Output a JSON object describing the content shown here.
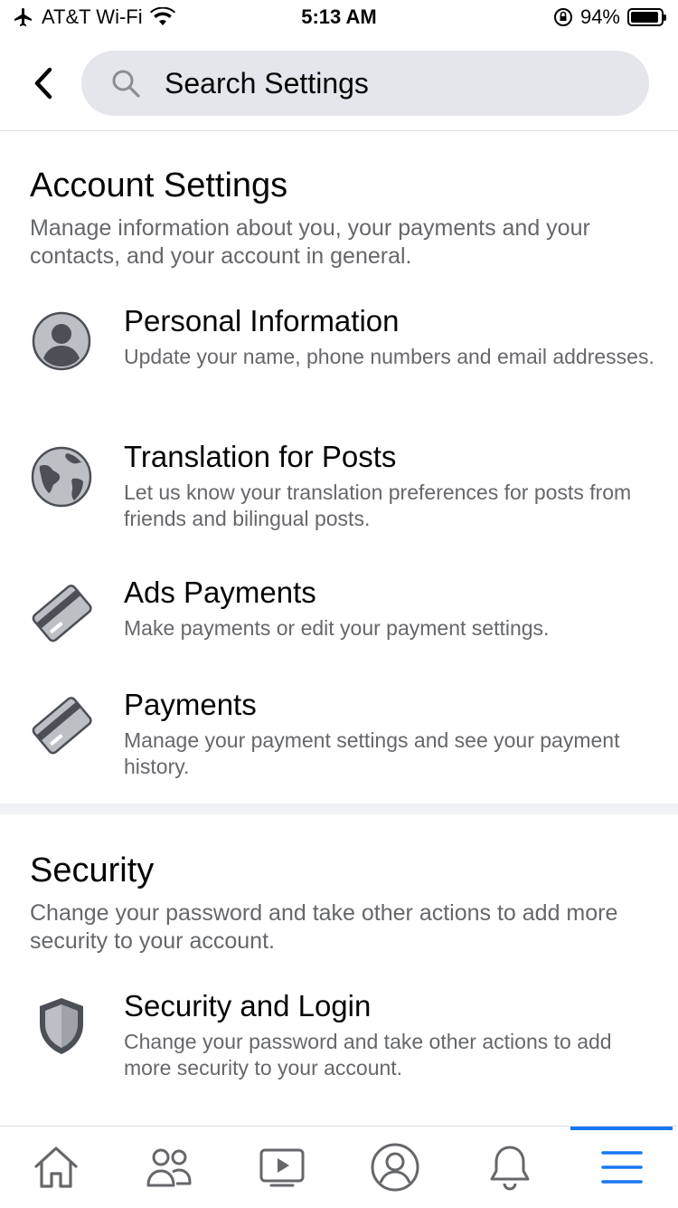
{
  "status_bar": {
    "carrier": "AT&T Wi-Fi",
    "time": "5:13 AM",
    "battery": "94%",
    "battery_level": 0.94,
    "icons": [
      "airplane-icon",
      "wifi-icon",
      "rotation-lock-icon",
      "battery-icon"
    ]
  },
  "header": {
    "back_icon": "chevron-left-icon",
    "search_placeholder": "Search Settings",
    "search_icon": "search-icon"
  },
  "sections": [
    {
      "title": "Account Settings",
      "description": "Manage information about you, your payments and your contacts, and your account in general.",
      "items": [
        {
          "title": "Personal Information",
          "description": "Update your name, phone numbers and email addresses.",
          "icon": "person-icon"
        },
        {
          "title": "Translation for Posts",
          "description": "Let us know your translation preferences for posts from friends and bilingual posts.",
          "icon": "globe-icon"
        },
        {
          "title": "Ads Payments",
          "description": "Make payments or edit your payment settings.",
          "icon": "credit-card-icon"
        },
        {
          "title": "Payments",
          "description": "Manage your payment settings and see your payment history.",
          "icon": "credit-card-icon"
        }
      ]
    },
    {
      "title": "Security",
      "description": "Change your password and take other actions to add more security to your account.",
      "items": [
        {
          "title": "Security and Login",
          "description": "Change your password and take other actions to add more security to your account.",
          "icon": "shield-icon"
        }
      ]
    }
  ],
  "tab_bar": {
    "tabs": [
      "home-icon",
      "friends-icon",
      "watch-icon",
      "profile-icon",
      "notifications-icon",
      "menu-icon"
    ],
    "active_tab": "menu-icon",
    "accent_color": "#1877f2"
  },
  "colors": {
    "primary_text": "#050505",
    "secondary_text": "#65676b",
    "search_background": "#e4e6eb",
    "icon_fill": "#bcc0c4",
    "icon_dark": "#4b4f56"
  }
}
